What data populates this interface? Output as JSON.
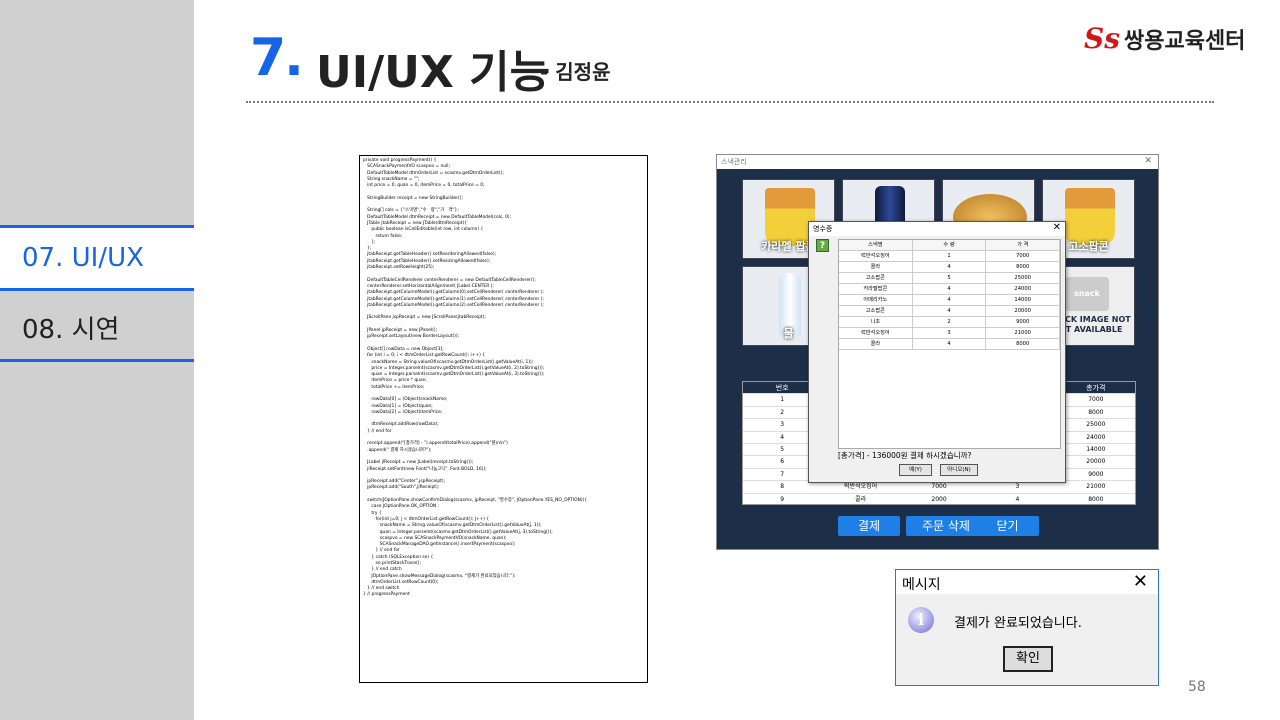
{
  "sidebar": {
    "items": [
      {
        "label": "07. UI/UX"
      },
      {
        "label": "08. 시연"
      }
    ]
  },
  "header": {
    "num": "7.",
    "title": "UI/UX 기능",
    "subtitle": "- 김정윤"
  },
  "logo": {
    "mark": "Ss",
    "text": "쌍용교육센터"
  },
  "code_lines": [
    "private void progressPayment() {",
    "   SCASnackPaymentVO scaspvo = null;",
    "   DefaultTableModel dtmOrderList = scasmv.getDtmOrderList();",
    "   String snackName = \"\";",
    "   int price = 0, quan = 0, itemPrice = 0, totalPrice = 0;",
    "",
    "   StringBuilder receipt = new StringBuilder();",
    "",
    "   String[] cols = {\"스낵명\",\"수   량\",\"가   격\"};",
    "   DefaultTableModel dtmReceipt = new DefaultTableModel(cols, 0);",
    "   JTable jtabReceipt = new JTable(dtmReceipt){",
    "      public boolean isCellEditable(int row, int column) {",
    "         return false;",
    "      };",
    "   };",
    "   jtabReceipt.getTableHeader().setReorderingAllowed(false);",
    "   jtabReceipt.getTableHeader().setResizingAllowed(false);",
    "   jtabReceipt.setRowHeight(25);",
    "",
    "   DefaultTableCellRenderer centerRenderer = new DefaultTableCellRenderer();",
    "   centerRenderer.setHorizontalAlignment( JLabel.CENTER );",
    "   jtabReceipt.getColumnModel().getColumn(0).setCellRenderer( centerRenderer );",
    "   jtabReceipt.getColumnModel().getColumn(1).setCellRenderer( centerRenderer );",
    "   jtabReceipt.getColumnModel().getColumn(2).setCellRenderer( centerRenderer );",
    "",
    "   JScrollPane jspReceipt = new JScrollPane(jtabReceipt);",
    "",
    "   JPanel jpReceipt = new JPanel();",
    "   jpReceipt.setLayout(new BorderLayout());",
    "",
    "   Object[] rowData = new Object[3];",
    "   for (int i = 0; i < dtmOrderList.getRowCount(); i++) {",
    "      snackName = String.valueOf(scasmv.getDtmOrderList().getValueAt(i, 1));",
    "      price = Integer.parseInt(scasmv.getDtmOrderList().getValueAt(i, 2).toString());",
    "      quan = Integer.parseInt(scasmv.getDtmOrderList().getValueAt(i, 3).toString());",
    "      itemPrice = price * quan;",
    "      totalPrice += itemPrice;",
    "",
    "      rowData[0] = (Object)snackName;",
    "      rowData[1] = (Object)quan;",
    "      rowData[2] = (Object)itemPrice;",
    "",
    "      dtmReceipt.addRow(rowData);",
    "   } // end for",
    "",
    "   receipt.append(\"[총가격] - \").append(totalPrice).append(\"원\\n\\n\")",
    "   .append(\" 결제 하시겠습니까?\");",
    "",
    "   JLabel jlReceipt = new JLabel(receipt.toString());",
    "   jlReceipt.setFont(new Font(\"나눔고딕\", Font.BOLD, 16));",
    "",
    "   jpReceipt.add(\"Center\",jspReceipt);",
    "   jpReceipt.add(\"South\",jlReceipt);",
    "",
    "   switch(JOptionPane.showConfirmDialog(scasmv, jpReceipt, \"영수증\", JOptionPane.YES_NO_OPTION)){",
    "      case JOptionPane.OK_OPTION :",
    "      try {",
    "         for(int j=0; j < dtmOrderList.getRowCount(); j++) {",
    "            snackName = String.valueOf(scasmv.getDtmOrderList().getValueAt(j, 1));",
    "            quan = Integer.parseInt(scasmv.getDtmOrderList().getValueAt(j, 3).toString());",
    "            scaspvo = new SCASnackPaymentVO(snackName, quan);",
    "            SCASnackManageDAO.getInstance().insertPayment(scaspvo);",
    "         } // end for",
    "      } catch (SQLException se) {",
    "         se.printStackTrace();",
    "      } // end catch",
    "      JOptionPane.showMessageDialog(scasmv, \"결제가 완료되었습니다.\");",
    "      dtmOrderList.setRowCount(0);",
    "   } // end switch",
    "} // progressPayment"
  ],
  "app": {
    "title": "스낵관리",
    "tiles": [
      {
        "label": "카라멜 팝콘"
      },
      {
        "label": ""
      },
      {
        "label": ""
      },
      {
        "label": "고소팝콘"
      },
      {
        "label": "물"
      },
      {
        "label": "SNACK IMAGE NOT YET AVAILABLE",
        "brand": "snack"
      }
    ],
    "order_table": {
      "headers": [
        "번호",
        "",
        "",
        "",
        "총가격"
      ],
      "rows": [
        [
          "1",
          "",
          "",
          "",
          "7000"
        ],
        [
          "2",
          "",
          "",
          "",
          "8000"
        ],
        [
          "3",
          "",
          "",
          "",
          "25000"
        ],
        [
          "4",
          "",
          "",
          "",
          "24000"
        ],
        [
          "5",
          "",
          "",
          "",
          "14000"
        ],
        [
          "6",
          "",
          "",
          "",
          "20000"
        ],
        [
          "7",
          "",
          "",
          "",
          "9000"
        ],
        [
          "8",
          "럭반석오징어",
          "7000",
          "3",
          "21000"
        ],
        [
          "9",
          "콜라",
          "2000",
          "4",
          "8000"
        ]
      ]
    },
    "buttons": [
      "결제",
      "주문 삭제",
      "닫기"
    ]
  },
  "receipt": {
    "title": "영수증",
    "icon": "?",
    "headers": [
      "스낵명",
      "수   량",
      "가   격"
    ],
    "rows": [
      [
        "럭반석오징어",
        "1",
        "7000"
      ],
      [
        "콜라",
        "4",
        "8000"
      ],
      [
        "고소팝콘",
        "5",
        "25000"
      ],
      [
        "카라멜팝콘",
        "4",
        "24000"
      ],
      [
        "아메리카노",
        "4",
        "14000"
      ],
      [
        "고소팝콘",
        "4",
        "20000"
      ],
      [
        "나초",
        "2",
        "9000"
      ],
      [
        "럭반석오징어",
        "3",
        "21000"
      ],
      [
        "콜라",
        "4",
        "8000"
      ]
    ],
    "message": "[총가격] - 136000원 결제 하시겠습니까?",
    "yes": "예(Y)",
    "no": "아니오(N)"
  },
  "msgbox": {
    "title": "메시지",
    "icon": "i",
    "text": "결제가 완료되었습니다.",
    "ok": "확인"
  },
  "page_number": "58"
}
